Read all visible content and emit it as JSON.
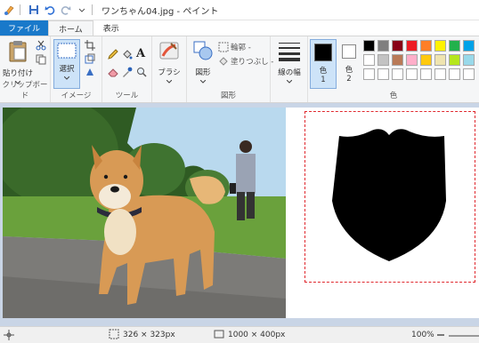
{
  "window": {
    "title": "ワンちゃん04.jpg - ペイント"
  },
  "tabs": [
    {
      "label": "ファイル"
    },
    {
      "label": "ホーム"
    },
    {
      "label": "表示"
    }
  ],
  "ribbon": {
    "clipboard": {
      "paste_label": "貼り付け",
      "group_label": "クリップボード"
    },
    "image": {
      "select_label": "選択",
      "group_label": "イメージ"
    },
    "tools": {
      "group_label": "ツール"
    },
    "brushes": {
      "label": "ブラシ"
    },
    "shapes": {
      "label": "図形",
      "outline_label": "輪郭 -",
      "fill_label": "塗りつぶし -",
      "group_label": "図形"
    },
    "size": {
      "label": "線の幅"
    },
    "colors": {
      "color1_label": "色",
      "color1_num": "1",
      "color2_label": "色",
      "color2_num": "2",
      "group_label": "色",
      "color1_value": "#000000",
      "color2_value": "#ffffff",
      "palette_row1": [
        "#000000",
        "#7f7f7f",
        "#880015",
        "#ed1c24",
        "#ff7f27",
        "#fff200",
        "#22b14c",
        "#00a2e8"
      ],
      "palette_row2": [
        "#ffffff",
        "#c3c3c3",
        "#b97a57",
        "#ffaec9",
        "#ffc90e",
        "#efe4b0",
        "#b5e61d",
        "#99d9ea"
      ]
    }
  },
  "status": {
    "selection_size": "326 × 323px",
    "image_size": "1000 × 400px",
    "zoom": "100%"
  },
  "canvas": {
    "shape_color": "#000000",
    "selection_color": "#e0282e"
  }
}
